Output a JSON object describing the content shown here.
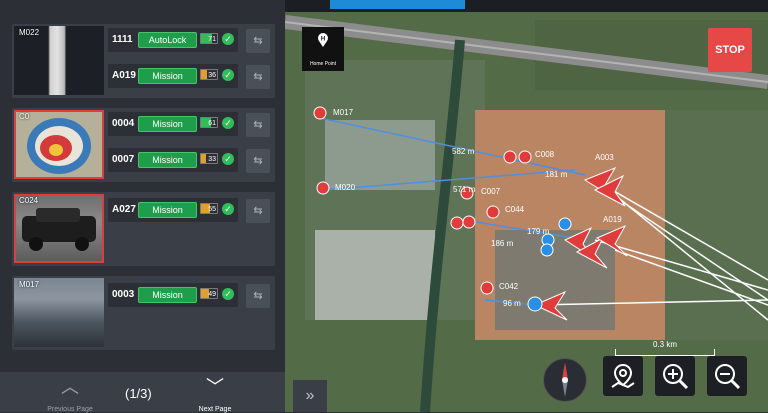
{
  "cards": [
    {
      "thumb_label": "M022",
      "rows": [
        {
          "id": "1111",
          "mode": "AutoLock",
          "battery": 71,
          "batt_color": "#2fbf58"
        },
        {
          "id": "A019",
          "mode": "Mission",
          "battery": 36,
          "batt_color": "#e0a030"
        }
      ]
    },
    {
      "thumb_label": "C0",
      "rows": [
        {
          "id": "0004",
          "mode": "Mission",
          "battery": 61,
          "batt_color": "#2fbf58"
        },
        {
          "id": "0007",
          "mode": "Mission",
          "battery": 33,
          "batt_color": "#e0a030"
        }
      ]
    },
    {
      "thumb_label": "C024",
      "rows": [
        {
          "id": "A027",
          "mode": "Mission",
          "battery": 55,
          "batt_color": "#e0a030"
        }
      ]
    },
    {
      "thumb_label": "M017",
      "rows": [
        {
          "id": "0003",
          "mode": "Mission",
          "battery": 49,
          "batt_color": "#e0a030"
        }
      ]
    }
  ],
  "pager": {
    "prev_label": "Previous Page",
    "next_label": "Next Page",
    "page": "(1/3)"
  },
  "map": {
    "home_point_label": "Home Point",
    "stop_label": "STOP",
    "scale_label": "0.3 km",
    "distance_labels": [
      "582 m",
      "181 m",
      "571 m",
      "179 m",
      "186 m",
      "96 m"
    ],
    "marker_labels": [
      "M017",
      "M020",
      "C042",
      "C007",
      "C044",
      "C008",
      "A003",
      "A019"
    ],
    "controls": [
      "map-pin-icon",
      "zoom-in-icon",
      "zoom-out-icon"
    ]
  }
}
